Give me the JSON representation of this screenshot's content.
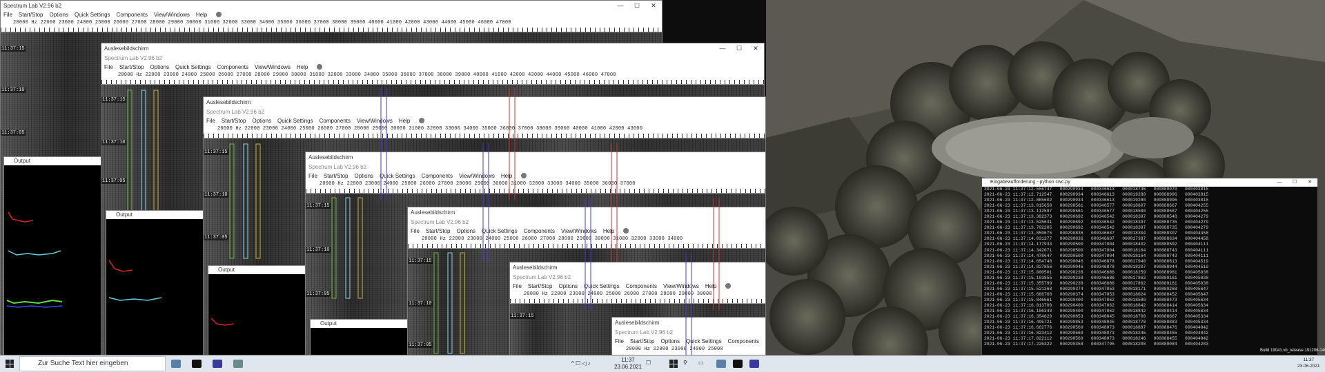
{
  "app": {
    "main_title": "Spectrum Lab V2.96 b2",
    "sub_title": "Spectrum Lab V2.96 b2",
    "child_window_title": "Auslesebildschirm",
    "output_title": "Output",
    "console_title": "Eingabeaufforderung - python  cwc.py"
  },
  "menu": [
    "File",
    "Start/Stop",
    "Options",
    "Quick Settings",
    "Components",
    "View/Windows",
    "Help"
  ],
  "window_controls": [
    "—",
    "☐",
    "✕"
  ],
  "scales": {
    "main": "20000 Hz      22000 23000 24000 25000 26000 27000 28000 29000 30000 31000 32000 33000 34000 35000 36000 37000 38000 39000 40000 41000 42000 43000 44000 45000 46000 47000",
    "w1": "20000 Hz        22000  23000  24000  25000  26000  27000  28000  29000  30000  31000  32000  33000  34000  35000  36000  37000  38000  39000  40000  41000  42000  43000  44000  45000  46000  47000",
    "w2": "20000 Hz        22000 23000 24000 25000 26000 27000 28000 29000 30000 31000 32000 33000 34000 35000 36000 37000 38000 39000 40000 41000 42000 43000",
    "w3": "20000 Hz        22000 23000 24000 25000 26000 27000 28000 29000 30000 31000 32000 33000 34000 35000 36000 37000",
    "w4": "20000 Hz        22000 23000 24000 25000 26000 27000 28000 29000 30000 31000 32000 33000 34000",
    "w5": "20000 Hz        22000 23000 24000 25000 26000 27000 28000 29000 30000",
    "w6": "20000 Hz        22000 23000 24000 25000"
  },
  "times": [
    "11:37:15",
    "11:37:10",
    "11:37:05"
  ],
  "console_lines": [
    "2021-06-23 11:37:12.556747   000290934   000346613   000018746   000889070   000403815",
    "2021-06-23 11:37:12.712547   000290934   000346613   000019280   000888996   000403815",
    "2021-06-23 11:37:12.865602   000290934   000346613   000019280   000888996   000403815",
    "2021-06-23 11:37:13.015650   000290561   000346577   000018607   000888667   000404255",
    "2021-06-23 11:37:13.112597   000290561   000346577   000018580   000888587   000404255",
    "2021-06-23 11:37:13.382373   000290692   000346542   000018397   000888548   000404279",
    "2021-06-23 11:37:13.525631   000290692   000346542   000018397   000888735   000404279",
    "2021-06-23 11:37:13.702205   000290692   000346542   000018397   000888735   000404279",
    "2021-06-23 11:37:13.859675   000290836   000346687   000018304   000888307   000404458",
    "2021-06-23 11:37:14.031377   000290836   000346687   000017387   000888634   000404458",
    "2021-06-23 11:37:14.177933   000290500   000347004   000018402   000888592   000404111",
    "2021-06-23 11:37:14.342071   000290500   000347004   000018164   000888743   000404111",
    "2021-06-23 11:37:14.478647   000290500   000347004   000018164   000888743   000404111",
    "2021-06-23 11:37:14.654748   000290046   000346878   000017940   000888813   000404519",
    "2021-06-23 11:37:14.827856   000290046   000346878   000018207   000888944   000404519",
    "2021-06-23 11:37:15.000501   000290238   000346686   000018259   000888981   000405038",
    "2021-06-23 11:37:15.183855   000290238   000346686   000017862   000889161   000405038",
    "2021-06-23 11:37:15.355799   000290238   000346686   000017862   000889161   000405038",
    "2021-06-23 11:37:15.521368   000290374   000347053   000018171   000889268   000405647",
    "2021-06-23 11:37:15.686768   000290374   000347053   000018024   000888452   000405647",
    "2021-06-23 11:37:15.846661   000290400   000347062   000018589   000888473   000405634",
    "2021-06-23 11:37:16.013700   000290400   000347062   000018842   000888414   000405634",
    "2021-06-23 11:37:16.186340   000290400   000347062   000018842   000888414   000405634",
    "2021-06-23 11:37:16.354620   000290853   000348045   000018700   000888667   000405334",
    "2021-06-23 11:37:16.495721   000290853   000348045   000018770   000888883   000405334",
    "2021-06-23 11:37:16.662776   000290569   000348073   000018887   000888476   000404842",
    "2021-06-23 11:37:16.823412   000290569   000348073   000018246   000888455   000404842",
    "2021-06-23 11:37:17.022112   000290569   000348073   000018246   000888455   000404842",
    "2021-06-23 11:37:17.226322   000290358   000347795   000018200   000889084   000404283"
  ],
  "taskbar": {
    "search_placeholder": "Zur Suche Text hier eingeben",
    "clock_time": "11:37",
    "clock_date": "23.06.2021",
    "right_clock_time": "11:37",
    "right_clock_date": "23.06.2021",
    "build_text": "Build 19041.vb_release.191206-1406"
  },
  "colors": {
    "channel_green": "#6dbb3c",
    "channel_cyan": "#8fd6e6",
    "channel_yellow": "#c9b83a",
    "marker_blue": "#3c3cc8",
    "marker_red": "#d23030",
    "output_red": "#e02020",
    "output_cyan": "#5fd0e0",
    "output_green": "#60e040",
    "output_blue": "#3050ff"
  }
}
